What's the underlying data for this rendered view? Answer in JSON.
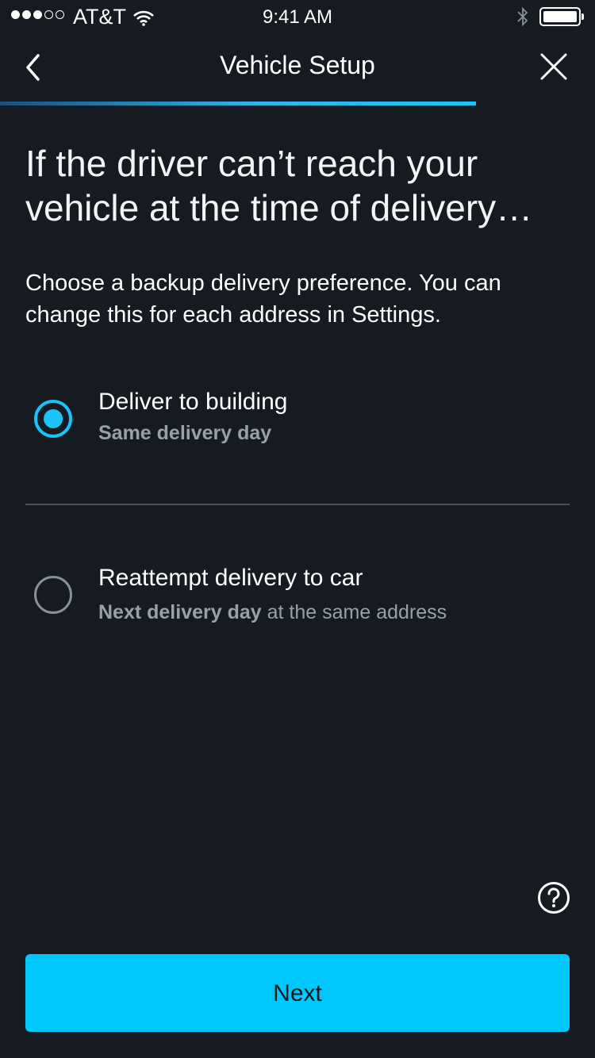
{
  "status_bar": {
    "carrier": "AT&T",
    "time": "9:41 AM",
    "signal_bars_filled": 3,
    "signal_bars_total": 5
  },
  "nav": {
    "title": "Vehicle Setup",
    "back_icon": "chevron-left-icon",
    "close_icon": "close-icon",
    "progress": 0.8
  },
  "content": {
    "headline": "If the driver can’t reach your vehicle at the time of delivery…",
    "instructions": "Choose a backup delivery preference. You can change this for each address in Settings."
  },
  "options": [
    {
      "title": "Deliver to building",
      "subtitle_bold": "Same delivery day",
      "subtitle_rest": "",
      "selected": true
    },
    {
      "title": "Reattempt delivery to car",
      "subtitle_bold": "Next delivery day",
      "subtitle_rest": " at the same address",
      "selected": false
    }
  ],
  "help_icon": "question-circle-icon",
  "next_button": {
    "label": "Next"
  },
  "colors": {
    "background": "#161b22",
    "accent": "#19c3f5",
    "button": "#00c8fa",
    "muted_text": "#9aa0a8"
  }
}
